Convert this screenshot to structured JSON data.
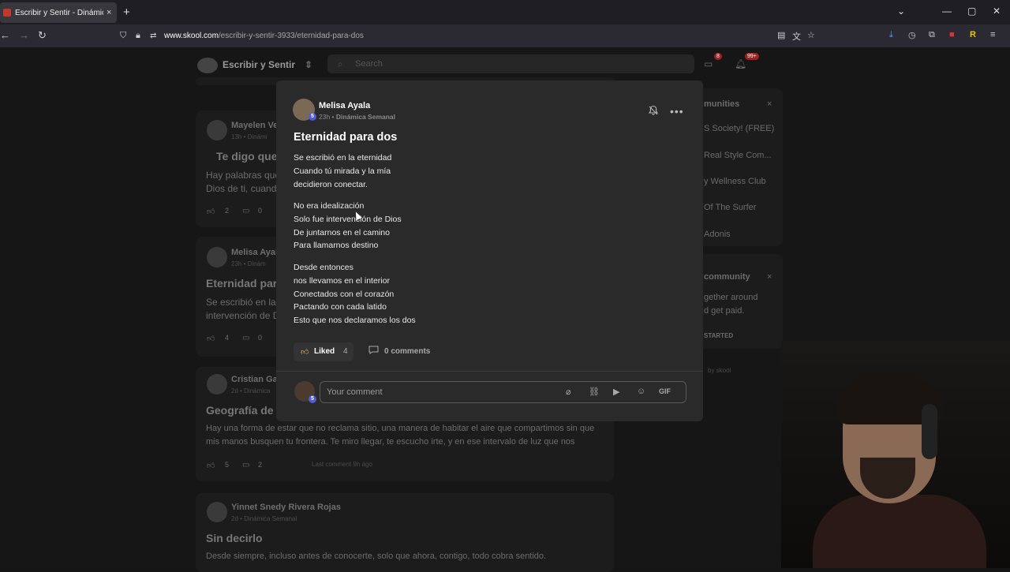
{
  "browser": {
    "tab_title": "Escribir y Sentir - Dinámica Semanal",
    "tab_close": "×",
    "new_tab": "+",
    "url_host": "www.skool.com",
    "url_path": "/escribir-y-sentir-3933/eternidad-para-dos"
  },
  "community": {
    "name": "Escribir y Sentir",
    "search_placeholder": "Search",
    "chat_badge": "8",
    "notif_badge": "99+"
  },
  "background_posts": [
    {
      "author": "Mayelen Ve",
      "meta": "13h • Dinámi",
      "title": "Te digo que",
      "line1": "Hay palabras que",
      "line2": "Dios de ti, cuando",
      "likes": "2",
      "comments": "0"
    },
    {
      "author": "Melisa Ayal",
      "meta": "23h • Dinám",
      "title": "Eternidad para",
      "line1": "Se escribió en la e",
      "line2": "intervención de Dio",
      "likes": "4",
      "comments": "0"
    },
    {
      "author": "Cristian Gar",
      "meta": "2d • Dinámica",
      "title": "Geografía de lo",
      "line1": "Hay una forma de estar que no reclama sitio, una manera de habitar el aire que compartimos sin que",
      "line2": "mis manos busquen tu frontera. Te miro llegar, te escucho irte, y en ese intervalo de luz que nos",
      "likes": "5",
      "comments": "2",
      "last": "Last comment 9h ago"
    },
    {
      "author": "Yinnet Snedy Rivera Rojas",
      "meta": "2d • Dinámica Semanal",
      "title": "Sin decirlo",
      "line1": "Desde siempre, incluso antes de conocerte, solo que ahora, contigo, todo cobra sentido.",
      "line2": "",
      "likes": "",
      "comments": ""
    }
  ],
  "sidebar": {
    "communities_title": "munities",
    "items": [
      "S Society! (FREE)",
      "Real Style Com...",
      "y Wellness Club",
      "Of The Surfer",
      "Adonis"
    ],
    "create_title": "community",
    "create_line1": "gether around",
    "create_line2": "d get paid.",
    "create_cta": "STARTED",
    "powered": "by skool"
  },
  "post": {
    "author": "Melisa Ayala",
    "level": "5",
    "time": "23h",
    "category": "Dinámica Semanal",
    "title": "Eternidad para dos",
    "stanzas": [
      [
        "Se escribió en la eternidad",
        "Cuando tú mirada y la mía",
        "decidieron conectar."
      ],
      [
        "No era idealización",
        "Solo fue intervención de Dios",
        "De juntarnos en el camino",
        "Para llamarnos destino"
      ],
      [
        "Desde entonces",
        "nos llevamos en el interior",
        "Conectados con el corazón",
        "Pactando con cada latido",
        "Esto que nos declaramos los dos"
      ]
    ],
    "liked_label": "Liked",
    "like_count": "4",
    "comments_label": "0 comments"
  },
  "comment": {
    "placeholder": "Your comment",
    "my_level": "5",
    "gif_label": "GIF"
  },
  "icons": {
    "more": "•••",
    "attach": "📎",
    "link": "🔗",
    "video": "▶",
    "emoji": "☺"
  },
  "colors": {
    "accent_level": "#4f5bd5",
    "modal_bg": "#2a2a2a",
    "like_icon": "#e8c25a"
  }
}
